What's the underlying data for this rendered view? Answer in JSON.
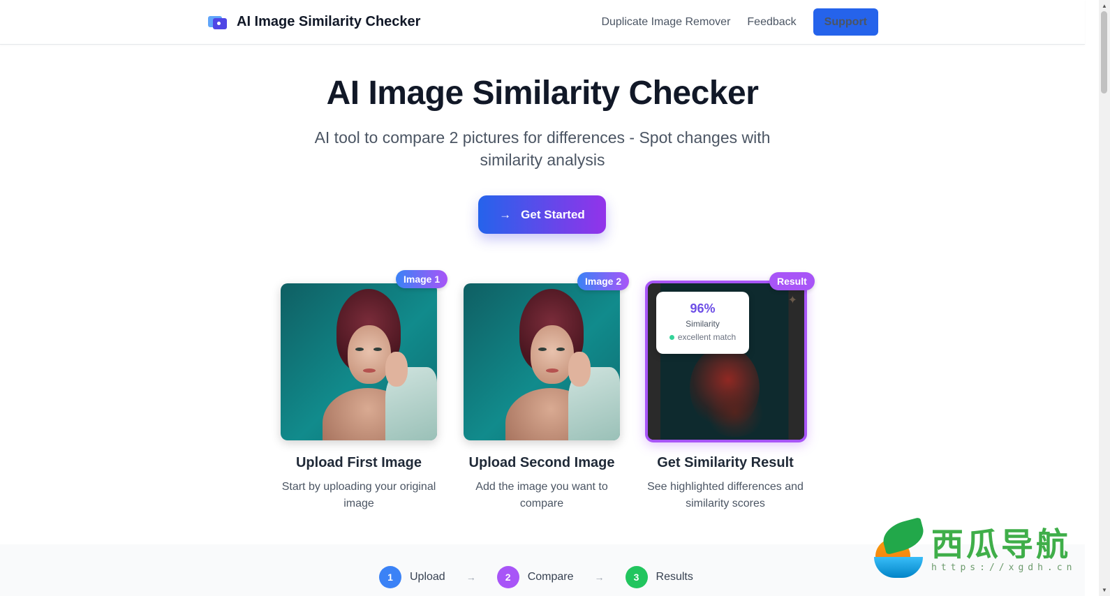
{
  "header": {
    "brand_title": "AI Image Similarity Checker",
    "nav": {
      "duplicate_remover": "Duplicate Image Remover",
      "feedback": "Feedback",
      "support": "Support"
    }
  },
  "hero": {
    "title": "AI Image Similarity Checker",
    "subtitle": "AI tool to compare 2 pictures for differences - Spot changes with similarity analysis",
    "cta_label": "Get Started"
  },
  "cards": [
    {
      "badge": "Image 1",
      "title": "Upload First Image",
      "desc": "Start by uploading your original image"
    },
    {
      "badge": "Image 2",
      "title": "Upload Second Image",
      "desc": "Add the image you want to compare"
    },
    {
      "badge": "Result",
      "title": "Get Similarity Result",
      "desc": "See highlighted differences and similarity scores"
    }
  ],
  "result": {
    "percent": "96%",
    "label": "Similarity",
    "match": "excellent match"
  },
  "steps": [
    {
      "num": "1",
      "label": "Upload",
      "color": "#3b82f6"
    },
    {
      "num": "2",
      "label": "Compare",
      "color": "#a855f7"
    },
    {
      "num": "3",
      "label": "Results",
      "color": "#22c55e"
    }
  ],
  "watermark": {
    "text": "西瓜导航",
    "url": "https://xgdh.cn"
  },
  "colors": {
    "primary": "#2563eb",
    "accent": "#a855f7"
  }
}
